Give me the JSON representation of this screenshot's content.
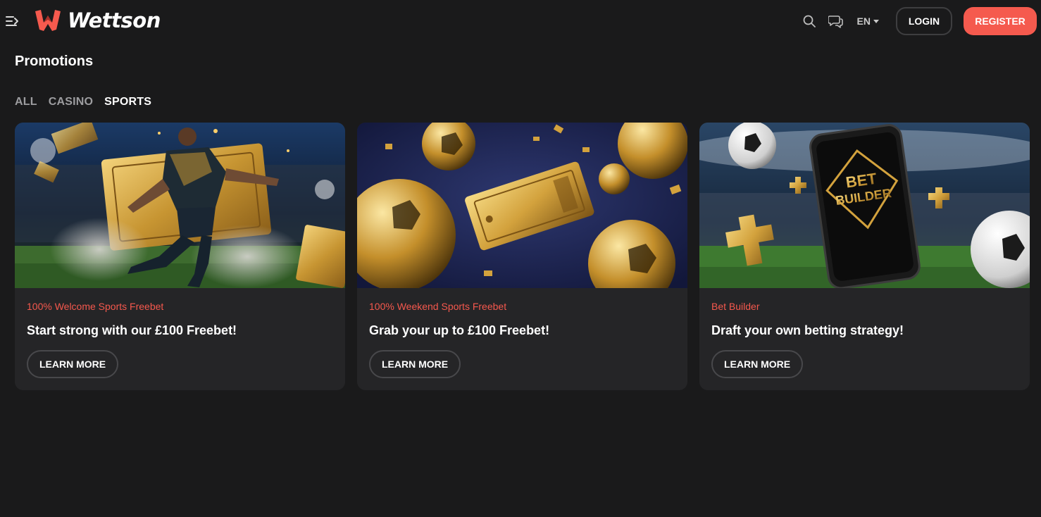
{
  "header": {
    "brand_name": "Wettson",
    "language": "EN",
    "login_label": "LOGIN",
    "register_label": "REGISTER",
    "icons": [
      "menu-toggle-icon",
      "search-icon",
      "chat-icon",
      "caret-down-icon"
    ]
  },
  "page": {
    "title": "Promotions",
    "tabs": [
      {
        "label": "ALL"
      },
      {
        "label": "CASINO"
      },
      {
        "label": "SPORTS"
      }
    ],
    "active_tab": "SPORTS"
  },
  "promotions": [
    {
      "tag": "100% Welcome Sports Freebet",
      "title": "Start strong with our £100 Freebet!",
      "button": "LEARN MORE"
    },
    {
      "tag": "100% Weekend Sports Freebet",
      "title": "Grab your up to £100 Freebet!",
      "button": "LEARN MORE"
    },
    {
      "tag": "Bet Builder",
      "title": "Draft your own betting strategy!",
      "button": "LEARN MORE",
      "image_text_line1": "BET",
      "image_text_line2": "BUILDER"
    }
  ],
  "colors": {
    "background": "#1a1a1b",
    "card": "#252527",
    "accent": "#f55a4e",
    "tag": "#f5584d",
    "gold": "#d4a63a"
  }
}
